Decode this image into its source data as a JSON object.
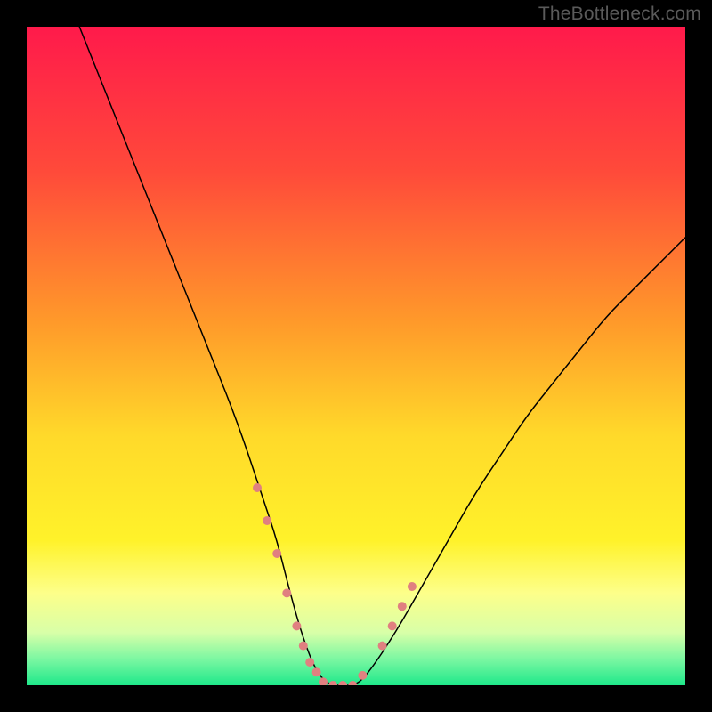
{
  "watermark": "TheBottleneck.com",
  "chart_data": {
    "type": "line",
    "title": "",
    "xlabel": "",
    "ylabel": "",
    "xlim": [
      0,
      100
    ],
    "ylim": [
      0,
      100
    ],
    "background": {
      "type": "vertical-gradient",
      "stops": [
        {
          "pos": 0.0,
          "color": "#ff1a4b"
        },
        {
          "pos": 0.22,
          "color": "#ff4a3a"
        },
        {
          "pos": 0.45,
          "color": "#ff9a2a"
        },
        {
          "pos": 0.62,
          "color": "#ffd92a"
        },
        {
          "pos": 0.78,
          "color": "#fff22a"
        },
        {
          "pos": 0.86,
          "color": "#fdff8a"
        },
        {
          "pos": 0.92,
          "color": "#d8ffa8"
        },
        {
          "pos": 0.96,
          "color": "#7cf7a2"
        },
        {
          "pos": 1.0,
          "color": "#1ee88a"
        }
      ]
    },
    "series": [
      {
        "name": "curve",
        "color": "#000000",
        "width": 1.5,
        "x": [
          8,
          12,
          16,
          20,
          24,
          28,
          32,
          36,
          38,
          40,
          42,
          44,
          46,
          48,
          50,
          52,
          56,
          60,
          64,
          68,
          72,
          76,
          80,
          84,
          88,
          92,
          96,
          100
        ],
        "y": [
          100,
          90,
          80,
          70,
          60,
          50,
          40,
          28,
          22,
          14,
          7,
          2,
          0,
          0,
          0,
          2,
          8,
          15,
          22,
          29,
          35,
          41,
          46,
          51,
          56,
          60,
          64,
          68
        ]
      }
    ],
    "markers": [
      {
        "name": "left-arm-dots",
        "color": "#e08080",
        "size": 10,
        "x": [
          35.0,
          36.5,
          38.0,
          39.5,
          41.0,
          42.0,
          43.0,
          44.0
        ],
        "y": [
          30.0,
          25.0,
          20.0,
          14.0,
          9.0,
          6.0,
          3.5,
          2.0
        ]
      },
      {
        "name": "valley-dots",
        "color": "#e08080",
        "size": 10,
        "x": [
          45.0,
          46.5,
          48.0,
          49.5,
          51.0
        ],
        "y": [
          0.5,
          0.0,
          0.0,
          0.0,
          1.5
        ]
      },
      {
        "name": "right-arm-dots",
        "color": "#e08080",
        "size": 10,
        "x": [
          54.0,
          55.5,
          57.0,
          58.5
        ],
        "y": [
          6.0,
          9.0,
          12.0,
          15.0
        ]
      }
    ]
  }
}
